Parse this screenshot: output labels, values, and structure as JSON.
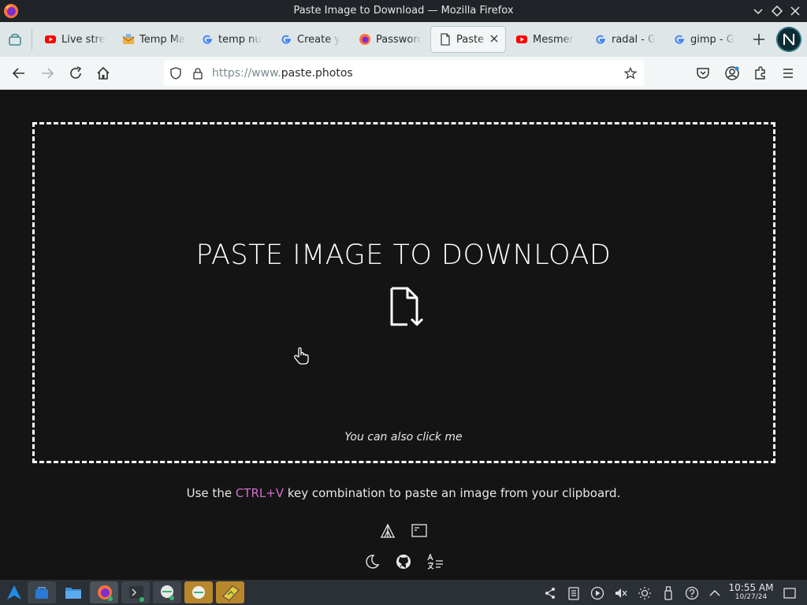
{
  "window": {
    "title": "Paste Image to Download — Mozilla Firefox"
  },
  "tabs": [
    {
      "label": "Live stre",
      "icon": "youtube-icon",
      "color": "#ff0000"
    },
    {
      "label": "Temp Ma",
      "icon": "mail-icon",
      "color": "#f0b040"
    },
    {
      "label": "temp nu",
      "icon": "google-icon",
      "color": "#4285f4"
    },
    {
      "label": "Create y",
      "icon": "google-icon",
      "color": "#4285f4"
    },
    {
      "label": "Passworc",
      "icon": "firefox-icon",
      "color": "#e66000"
    },
    {
      "label": "Paste I",
      "icon": "page-icon",
      "color": "#444444",
      "active": true
    },
    {
      "label": "Mesmer",
      "icon": "youtube-icon",
      "color": "#ff0000"
    },
    {
      "label": "radal - G",
      "icon": "google-icon",
      "color": "#4285f4"
    },
    {
      "label": "gimp - G",
      "icon": "google-icon",
      "color": "#4285f4"
    }
  ],
  "navbar": {
    "url_proto": "https://www.",
    "url_host": "paste.photos"
  },
  "page": {
    "headline": "PASTE IMAGE TO DOWNLOAD",
    "click_hint": "You can also click me",
    "instructions_pre": "Use the ",
    "instructions_key": "CTRL+V",
    "instructions_post": " key combination to paste an image from your clipboard."
  },
  "footer_icons": [
    "camp-icon",
    "window-icon",
    "moon-icon",
    "github-icon",
    "translate-icon"
  ],
  "taskbar": {
    "time": "10:55 AM",
    "date": "10/27/24"
  },
  "colors": {
    "page_bg": "#141414",
    "accent_key": "#d070c8",
    "tabstrip_bg": "#dfe6e8",
    "navbar_bg": "#f3f6f7"
  }
}
